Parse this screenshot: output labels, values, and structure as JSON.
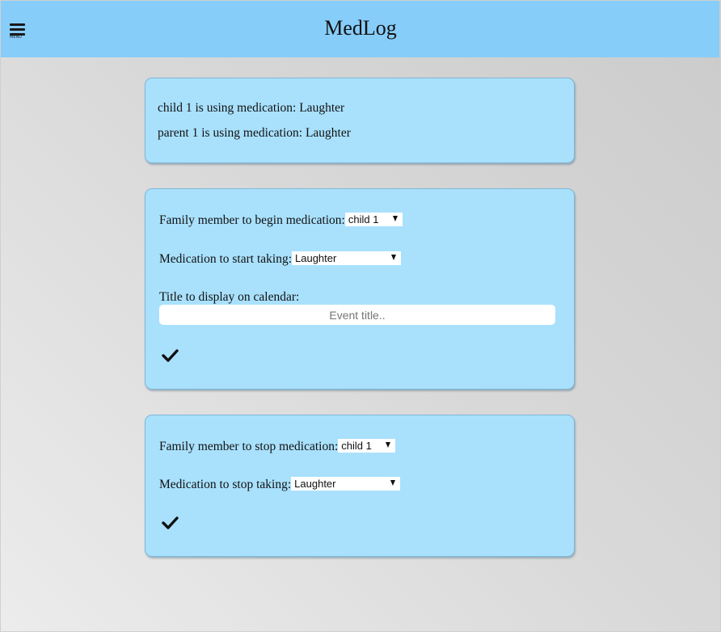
{
  "header": {
    "title": "MedLog",
    "menu_label": "MENU"
  },
  "status_card": {
    "lines": [
      "child 1 is using medication: Laughter",
      "parent 1 is using medication: Laughter"
    ]
  },
  "begin_form": {
    "member_label": "Family member to begin medication:",
    "member_selected": "child 1",
    "medication_label": "Medication to start taking:",
    "medication_selected": "Laughter",
    "title_label": "Title to display on calendar:",
    "title_placeholder": "Event title..",
    "submit_icon": "checkmark-icon"
  },
  "stop_form": {
    "member_label": "Family member to stop medication:",
    "member_selected": "child 1",
    "medication_label": "Medication to stop taking:",
    "medication_selected": "Laughter",
    "submit_icon": "checkmark-icon"
  },
  "colors": {
    "header_bg": "#87cdf9",
    "card_bg": "#a9e1fd",
    "card_border": "#7fb7d6",
    "page_bg": "#d9d9d9"
  }
}
